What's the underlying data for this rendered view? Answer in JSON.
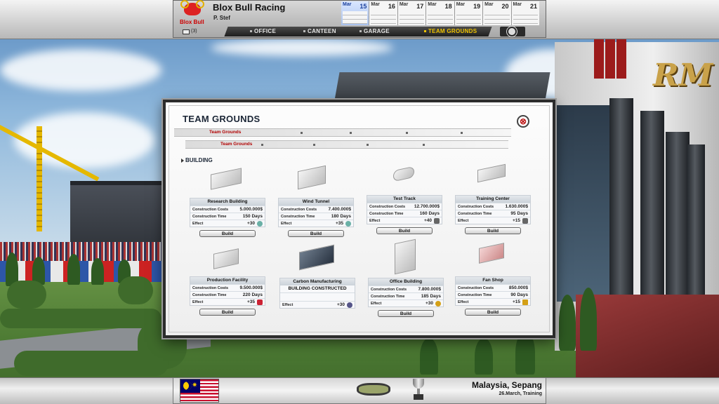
{
  "header": {
    "team_logo_text": "Blox Bull",
    "team_name": "Blox Bull Racing",
    "manager": "P. Stef",
    "mail_count": "(3)",
    "nav": [
      {
        "label": "OFFICE",
        "active": false
      },
      {
        "label": "CANTEEN",
        "active": false
      },
      {
        "label": "GARAGE",
        "active": false
      },
      {
        "label": "TEAM GROUNDS",
        "active": true
      }
    ],
    "calendar": [
      {
        "month": "Mar",
        "day": "15",
        "current": true
      },
      {
        "month": "Mar",
        "day": "16",
        "current": false
      },
      {
        "month": "Mar",
        "day": "17",
        "current": false
      },
      {
        "month": "Mar",
        "day": "18",
        "current": false
      },
      {
        "month": "Mar",
        "day": "19",
        "current": false
      },
      {
        "month": "Mar",
        "day": "20",
        "current": false
      },
      {
        "month": "Mar",
        "day": "21",
        "current": false
      }
    ]
  },
  "dialog": {
    "title": "TEAM GROUNDS",
    "breadcrumb_1": "Team Grounds",
    "breadcrumb_2": "Team Grounds",
    "section": "BUILDING",
    "labels": {
      "cost": "Construction Costs",
      "time": "Construction Time",
      "effect": "Effect",
      "build": "Build"
    },
    "facilities": [
      {
        "name": "Research Building",
        "cost": "5.000.000$",
        "time": "150 Days",
        "effect": "+30",
        "icon": "flask-icon",
        "constructed": false
      },
      {
        "name": "Wind Tunnel",
        "cost": "7.400.000$",
        "time": "180 Days",
        "effect": "+35",
        "icon": "flask-icon",
        "constructed": false
      },
      {
        "name": "Test Track",
        "cost": "12.700.000$",
        "time": "160 Days",
        "effect": "+40",
        "icon": "car-icon",
        "constructed": false
      },
      {
        "name": "Training Center",
        "cost": "1.630.000$",
        "time": "95 Days",
        "effect": "+15",
        "icon": "car-icon",
        "constructed": false
      },
      {
        "name": "Production Facility",
        "cost": "9.500.000$",
        "time": "220 Days",
        "effect": "+35",
        "icon": "wrench-icon",
        "constructed": false
      },
      {
        "name": "Carbon Manufacturing",
        "status": "BUILDING CONSTRUCTED",
        "effect": "+30",
        "icon": "magnifier-icon",
        "constructed": true
      },
      {
        "name": "Office Building",
        "cost": "7.800.000$",
        "time": "185 Days",
        "effect": "+30",
        "icon": "people-icon",
        "constructed": false
      },
      {
        "name": "Fan Shop",
        "cost": "850.000$",
        "time": "90 Days",
        "effect": "+15",
        "icon": "trophy-icon",
        "constructed": false
      }
    ]
  },
  "footer": {
    "location": "Malaysia, Sepang",
    "date": "26.March, Training"
  },
  "colors": {
    "accent_yellow": "#f0c400",
    "crumb_red": "#b10000",
    "title_navy": "#1b2636"
  }
}
